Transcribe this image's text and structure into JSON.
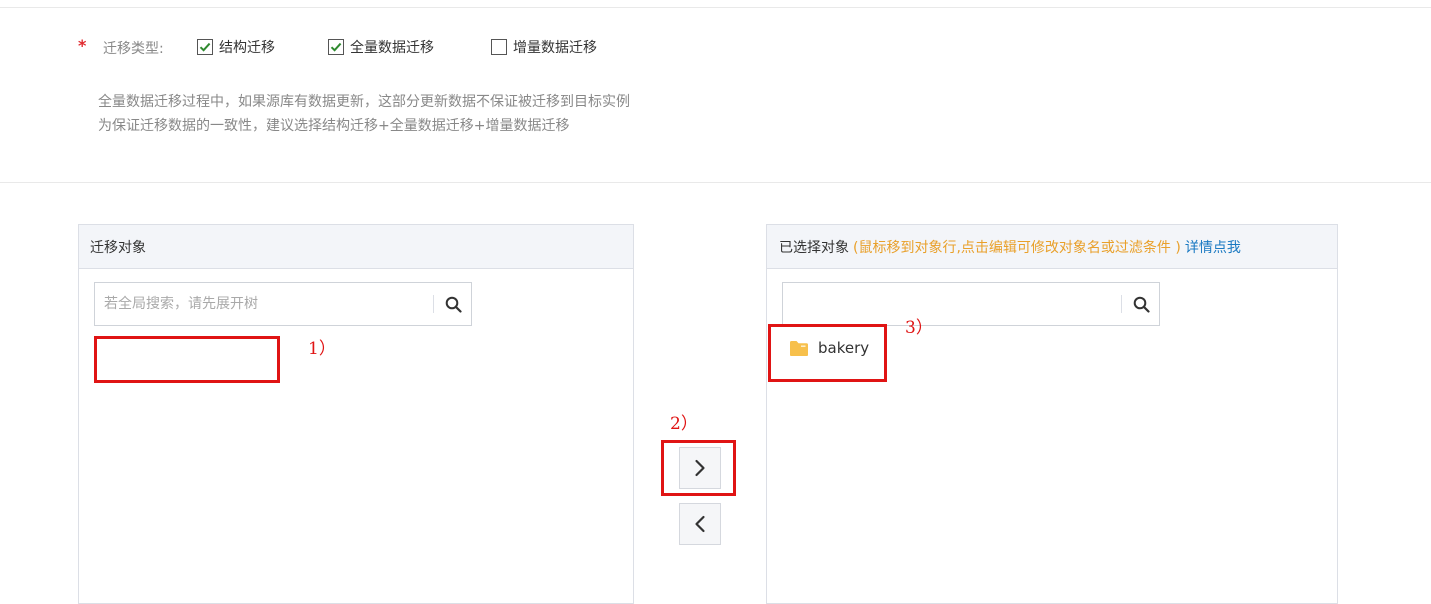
{
  "migration_type": {
    "required_mark": "*",
    "label": "迁移类型:",
    "options": [
      {
        "label": "结构迁移",
        "checked": true
      },
      {
        "label": "全量数据迁移",
        "checked": true
      },
      {
        "label": "增量数据迁移",
        "checked": false
      }
    ],
    "hint_lines": [
      "全量数据迁移过程中，如果源库有数据更新，这部分更新数据不保证被迁移到目标实例",
      "为保证迁移数据的一致性，建议选择结构迁移+全量数据迁移+增量数据迁移"
    ]
  },
  "source_panel": {
    "title": "迁移对象",
    "search_placeholder": "若全局搜索，请先展开树",
    "search_icon": "search-icon"
  },
  "target_panel": {
    "title": "已选择对象",
    "note": "(鼠标移到对象行,点击编辑可修改对象名或过滤条件 )",
    "detail_link": "详情点我",
    "search_placeholder": "",
    "search_icon": "search-icon",
    "items": [
      {
        "label": "bakery",
        "icon": "folder-icon"
      }
    ]
  },
  "transfer_buttons": {
    "add_icon": "chevron-right-icon",
    "remove_icon": "chevron-left-icon"
  },
  "annotations": {
    "step1": "1）",
    "step2": "2）",
    "step3": "3）",
    "highlight_color": "#e01414"
  },
  "colors": {
    "checkbox_check": "#2f8a2f",
    "note_orange": "#e9a02a",
    "link_blue": "#1a79c2",
    "folder_yellow": "#f7c04c"
  }
}
